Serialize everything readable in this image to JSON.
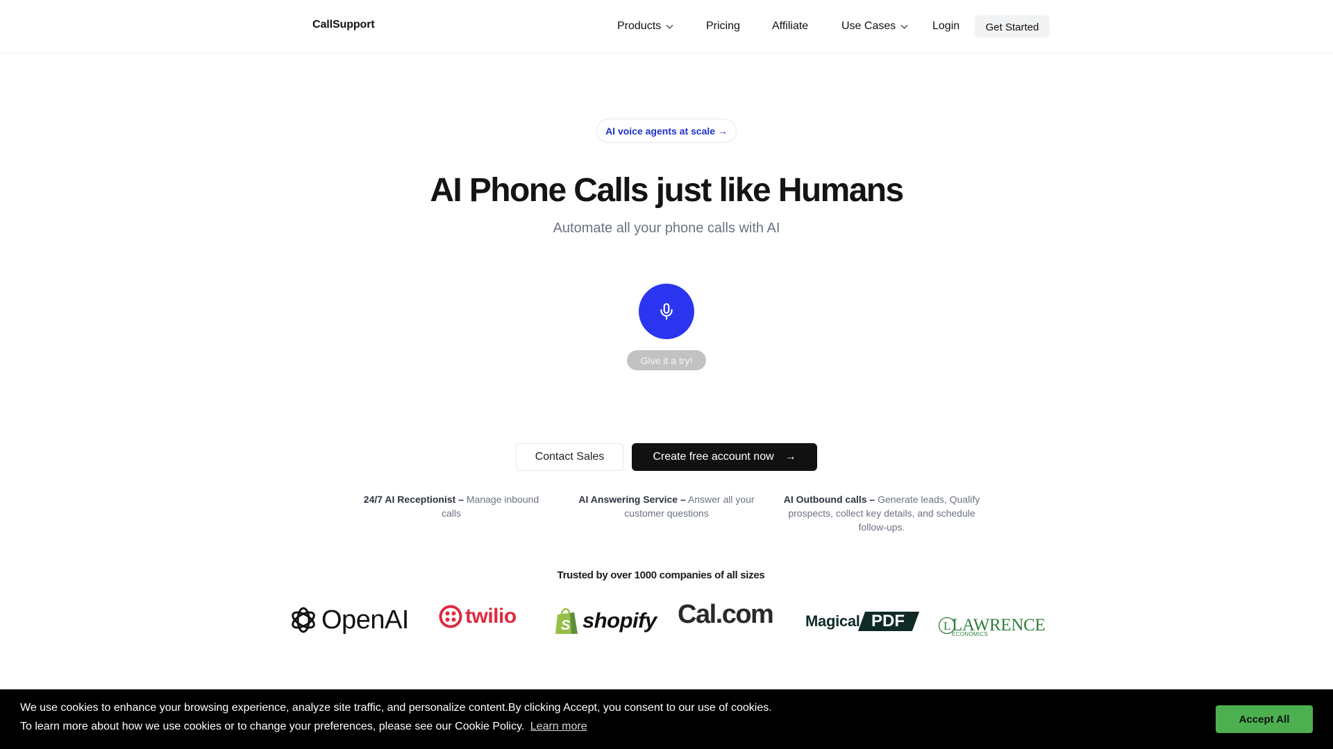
{
  "header": {
    "brand": "CallSupport",
    "nav": [
      {
        "label": "Products",
        "has_dropdown": true
      },
      {
        "label": "Pricing",
        "has_dropdown": false
      },
      {
        "label": "Affiliate",
        "has_dropdown": false
      },
      {
        "label": "Use Cases",
        "has_dropdown": true
      },
      {
        "label": "Login",
        "has_dropdown": false
      }
    ],
    "cta_label": "Get Started"
  },
  "hero": {
    "badge": "AI voice agents at scale →",
    "title": "AI Phone Calls just like Humans",
    "subtitle": "Automate all your phone calls with AI",
    "mic_icon": "microphone-icon",
    "try_label": "Give it a try!",
    "contact_label": "Contact Sales",
    "create_label": "Create free account now",
    "create_icon": "→"
  },
  "features": [
    {
      "title": "24/7 AI Receptionist –",
      "text": "Manage inbound calls"
    },
    {
      "title": "AI Answering Service –",
      "text": "Answer all your customer questions"
    },
    {
      "title": "AI Outbound calls –",
      "text": "Generate leads, Qualify prospects, collect key details, and schedule follow-ups."
    }
  ],
  "trusted": {
    "heading": "Trusted by over 1000 companies of all sizes",
    "logos": [
      {
        "name": "OpenAI",
        "text": "OpenAI"
      },
      {
        "name": "Twilio",
        "text": "twilio"
      },
      {
        "name": "Shopify",
        "text": "shopify"
      },
      {
        "name": "Cal.com",
        "text": "Cal.com"
      },
      {
        "name": "MagicalPDF",
        "text": "Magical",
        "text2": "PDF"
      },
      {
        "name": "Lawrence Economics",
        "text": "LAWRENCE",
        "text2": "ECONOMICS"
      }
    ]
  },
  "cookie": {
    "line1": "We use cookies to enhance your browsing experience, analyze site traffic, and personalize content.By clicking Accept, you consent to our use of cookies.",
    "line2": "To learn more about how we use cookies or to change your preferences, please see our Cookie Policy.",
    "link_label": "Learn more",
    "accept_label": "Accept All"
  },
  "colors": {
    "accent_blue": "#2b35f0",
    "badge_text": "#1d2fc9",
    "accept_green": "#4caf50",
    "twilio_red": "#e0293e",
    "shopify_green": "#95bf47",
    "lawrence_green": "#2f7d3b"
  }
}
